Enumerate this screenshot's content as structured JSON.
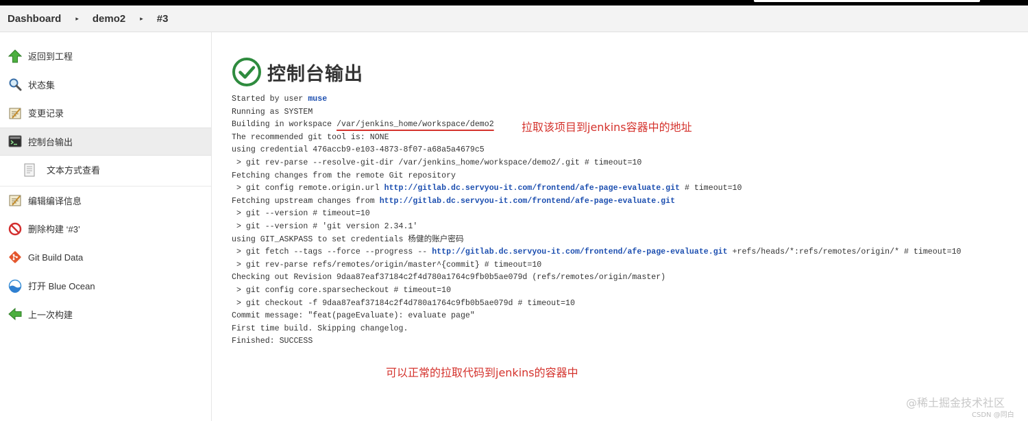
{
  "breadcrumb": {
    "items": [
      "Dashboard",
      "demo2",
      "#3"
    ],
    "separator": "▸"
  },
  "sidebar": {
    "items": [
      {
        "label": "返回到工程",
        "icon": "up-arrow-icon"
      },
      {
        "label": "状态集",
        "icon": "magnifier-icon"
      },
      {
        "label": "变更记录",
        "icon": "notepad-icon"
      },
      {
        "label": "控制台输出",
        "icon": "terminal-icon"
      },
      {
        "label": "文本方式查看",
        "icon": "document-icon"
      },
      {
        "label": "编辑编译信息",
        "icon": "notepad-edit-icon"
      },
      {
        "label": "删除构建 ‘#3’",
        "icon": "no-entry-icon"
      },
      {
        "label": "Git Build Data",
        "icon": "git-icon"
      },
      {
        "label": "打开 Blue Ocean",
        "icon": "blue-ocean-icon"
      },
      {
        "label": "上一次构建",
        "icon": "left-arrow-icon"
      }
    ]
  },
  "main": {
    "title": "控制台输出",
    "console": {
      "l1_pre": "Started by user ",
      "l1_user": "muse",
      "l2": "Running as SYSTEM",
      "l3_pre": "Building in workspace ",
      "l3_path": "/var/jenkins_home/workspace/demo2",
      "l4": "The recommended git tool is: NONE",
      "l5": "using credential 476accb9-e103-4873-8f07-a68a5a4679c5",
      "l6": " > git rev-parse --resolve-git-dir /var/jenkins_home/workspace/demo2/.git # timeout=10",
      "l7": "Fetching changes from the remote Git repository",
      "l8_pre": " > git config remote.origin.url ",
      "l8_link": "http://gitlab.dc.servyou-it.com/frontend/afe-page-evaluate.git",
      "l8_post": " # timeout=10",
      "l9_pre": "Fetching upstream changes from ",
      "l9_link": "http://gitlab.dc.servyou-it.com/frontend/afe-page-evaluate.git",
      "l10": " > git --version # timeout=10",
      "l11": " > git --version # 'git version 2.34.1'",
      "l12": "using GIT_ASKPASS to set credentials 杨健的账户密码",
      "l13_pre": " > git fetch --tags --force --progress -- ",
      "l13_link": "http://gitlab.dc.servyou-it.com/frontend/afe-page-evaluate.git",
      "l13_post": " +refs/heads/*:refs/remotes/origin/* # timeout=10",
      "l14": " > git rev-parse refs/remotes/origin/master^{commit} # timeout=10",
      "l15": "Checking out Revision 9daa87eaf37184c2f4d780a1764c9fb0b5ae079d (refs/remotes/origin/master)",
      "l16": " > git config core.sparsecheckout # timeout=10",
      "l17": " > git checkout -f 9daa87eaf37184c2f4d780a1764c9fb0b5ae079d # timeout=10",
      "l18": "Commit message: \"feat(pageEvaluate): evaluate page\"",
      "l19": "First time build. Skipping changelog.",
      "l20": "Finished: SUCCESS"
    }
  },
  "annotations": {
    "workspace_note": "拉取该项目到jenkins容器中的地址",
    "success_note": "可以正常的拉取代码到jenkins的容器中"
  },
  "watermark": {
    "main": "@稀土掘金技术社区",
    "small": "CSDN @同白"
  },
  "colors": {
    "link": "#1d4fb0",
    "annotation": "#d4322c",
    "success": "#2e8b3e"
  }
}
